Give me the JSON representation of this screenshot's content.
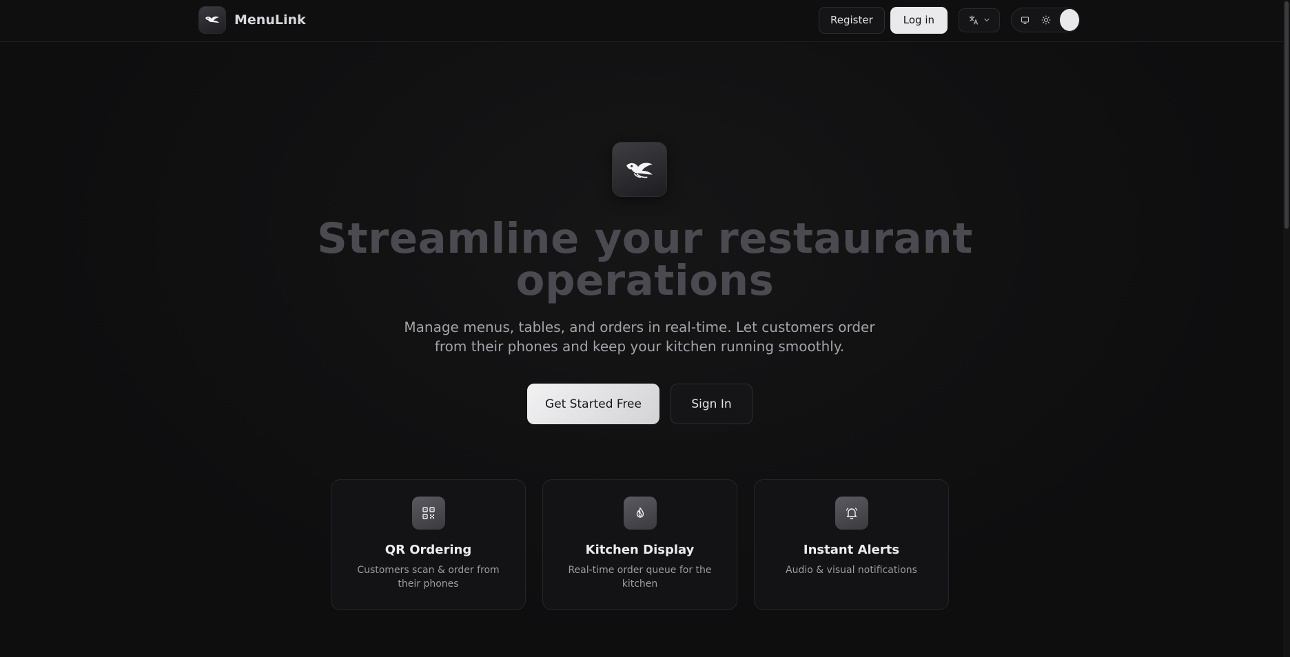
{
  "header": {
    "brand_name": "MenuLink",
    "register_label": "Register",
    "login_label": "Log in"
  },
  "hero": {
    "title": "Streamline your restaurant operations",
    "subtitle": "Manage menus, tables, and orders in real-time. Let customers order from their phones and keep your kitchen running smoothly.",
    "primary_cta": "Get Started Free",
    "secondary_cta": "Sign In"
  },
  "features": [
    {
      "icon": "qr-code-icon",
      "title": "QR Ordering",
      "description": "Customers scan & order from their phones"
    },
    {
      "icon": "flame-icon",
      "title": "Kitchen Display",
      "description": "Real-time order queue for the kitchen"
    },
    {
      "icon": "bell-icon",
      "title": "Instant Alerts",
      "description": "Audio & visual notifications"
    }
  ],
  "colors": {
    "background": "#0f0f10",
    "title_color": "#4a4a50",
    "primary_button": "#eaeaec"
  }
}
